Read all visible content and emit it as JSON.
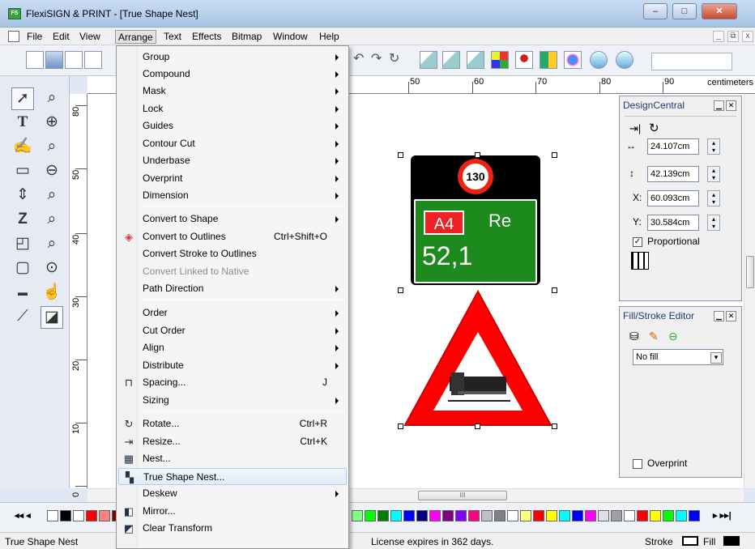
{
  "window": {
    "title": "FlexiSIGN & PRINT - [True Shape Nest]",
    "icon_text": "FS",
    "minimize": "–",
    "maximize": "□",
    "close": "✕"
  },
  "menubar": {
    "items": [
      "File",
      "Edit",
      "View",
      "Arrange",
      "Text",
      "Effects",
      "Bitmap",
      "Window",
      "Help"
    ],
    "mdi_minimize": "_",
    "mdi_restore": "⧉",
    "mdi_close": "x"
  },
  "ruler": {
    "h_labels": [
      "50",
      "60",
      "70",
      "80",
      "90"
    ],
    "units": "centimeters",
    "v_labels": [
      "80",
      "50",
      "40",
      "30",
      "20",
      "10",
      "0"
    ]
  },
  "arrange_menu": {
    "items": [
      {
        "label": "Group",
        "submenu": true
      },
      {
        "label": "Compound",
        "submenu": true
      },
      {
        "label": "Mask",
        "submenu": true
      },
      {
        "label": "Lock",
        "submenu": true
      },
      {
        "label": "Guides",
        "submenu": true
      },
      {
        "label": "Contour Cut",
        "submenu": true
      },
      {
        "label": "Underbase",
        "submenu": true
      },
      {
        "label": "Overprint",
        "submenu": true
      },
      {
        "label": "Dimension",
        "submenu": true
      },
      {
        "label": "Convert to Shape",
        "submenu": true
      },
      {
        "label": "Convert to Outlines",
        "shortcut": "Ctrl+Shift+O",
        "icon": "outline-icon"
      },
      {
        "label": "Convert Stroke to Outlines"
      },
      {
        "label": "Convert Linked to Native",
        "disabled": true
      },
      {
        "label": "Path Direction",
        "submenu": true
      },
      {
        "label": "Order",
        "submenu": true
      },
      {
        "label": "Cut Order",
        "submenu": true
      },
      {
        "label": "Align",
        "submenu": true
      },
      {
        "label": "Distribute",
        "submenu": true
      },
      {
        "label": "Spacing...",
        "shortcut": "J",
        "icon": "spacing-icon"
      },
      {
        "label": "Sizing",
        "submenu": true
      },
      {
        "label": "Rotate...",
        "shortcut": "Ctrl+R",
        "icon": "rotate-icon"
      },
      {
        "label": "Resize...",
        "shortcut": "Ctrl+K",
        "icon": "resize-icon"
      },
      {
        "label": "Nest...",
        "icon": "nest-icon"
      },
      {
        "label": "True Shape Nest...",
        "icon": "true-shape-nest-icon",
        "highlighted": true
      },
      {
        "label": "Deskew",
        "submenu": true
      },
      {
        "label": "Mirror...",
        "icon": "mirror-icon"
      },
      {
        "label": "Clear Transform",
        "icon": "clear-transform-icon"
      }
    ]
  },
  "design_central": {
    "title": "DesignCentral",
    "width": "24.107cm",
    "height": "42.139cm",
    "x_label": "X:",
    "x_value": "60.093cm",
    "y_label": "Y:",
    "y_value": "30.584cm",
    "proportional_label": "Proportional",
    "proportional_checked": true,
    "width_symbol": "↔",
    "height_symbol": "↕"
  },
  "fill_stroke": {
    "title": "Fill/Stroke Editor",
    "fill_select": "No fill",
    "overprint_label": "Overprint"
  },
  "artwork": {
    "speed": "130",
    "tag": "A4",
    "re": "Re",
    "km": "52,1"
  },
  "scroll": {
    "h_thumb": "III"
  },
  "palette": {
    "nav_left": "◂◂ ◂",
    "nav_right": "▸ ▸▸|",
    "colors": [
      "#ffffff",
      "#000000",
      "#ffffff",
      "#ff0000",
      "#ff8080",
      "#800000",
      "#ff8000",
      "#ffff00",
      "#80ff80",
      "#00ff00",
      "#008000",
      "#00ffff",
      "#0000ff",
      "#000080",
      "#ff00ff",
      "#800080",
      "#8000ff",
      "#ff0080",
      "#c0c0c0",
      "#808080",
      "#ffffff",
      "#ffff80",
      "#ff0000",
      "#ffff00",
      "#00ffff",
      "#0000ff",
      "#ff00ff",
      "#e0e0e0",
      "#a0a0a0",
      "#ffffff",
      "#ff0000",
      "#ffff00",
      "#00ff00",
      "#00ffff",
      "#0000ff"
    ]
  },
  "status": {
    "left": "True Shape Nest",
    "license": "License expires in 362 days.",
    "stroke_label": "Stroke",
    "fill_label": "Fill"
  }
}
